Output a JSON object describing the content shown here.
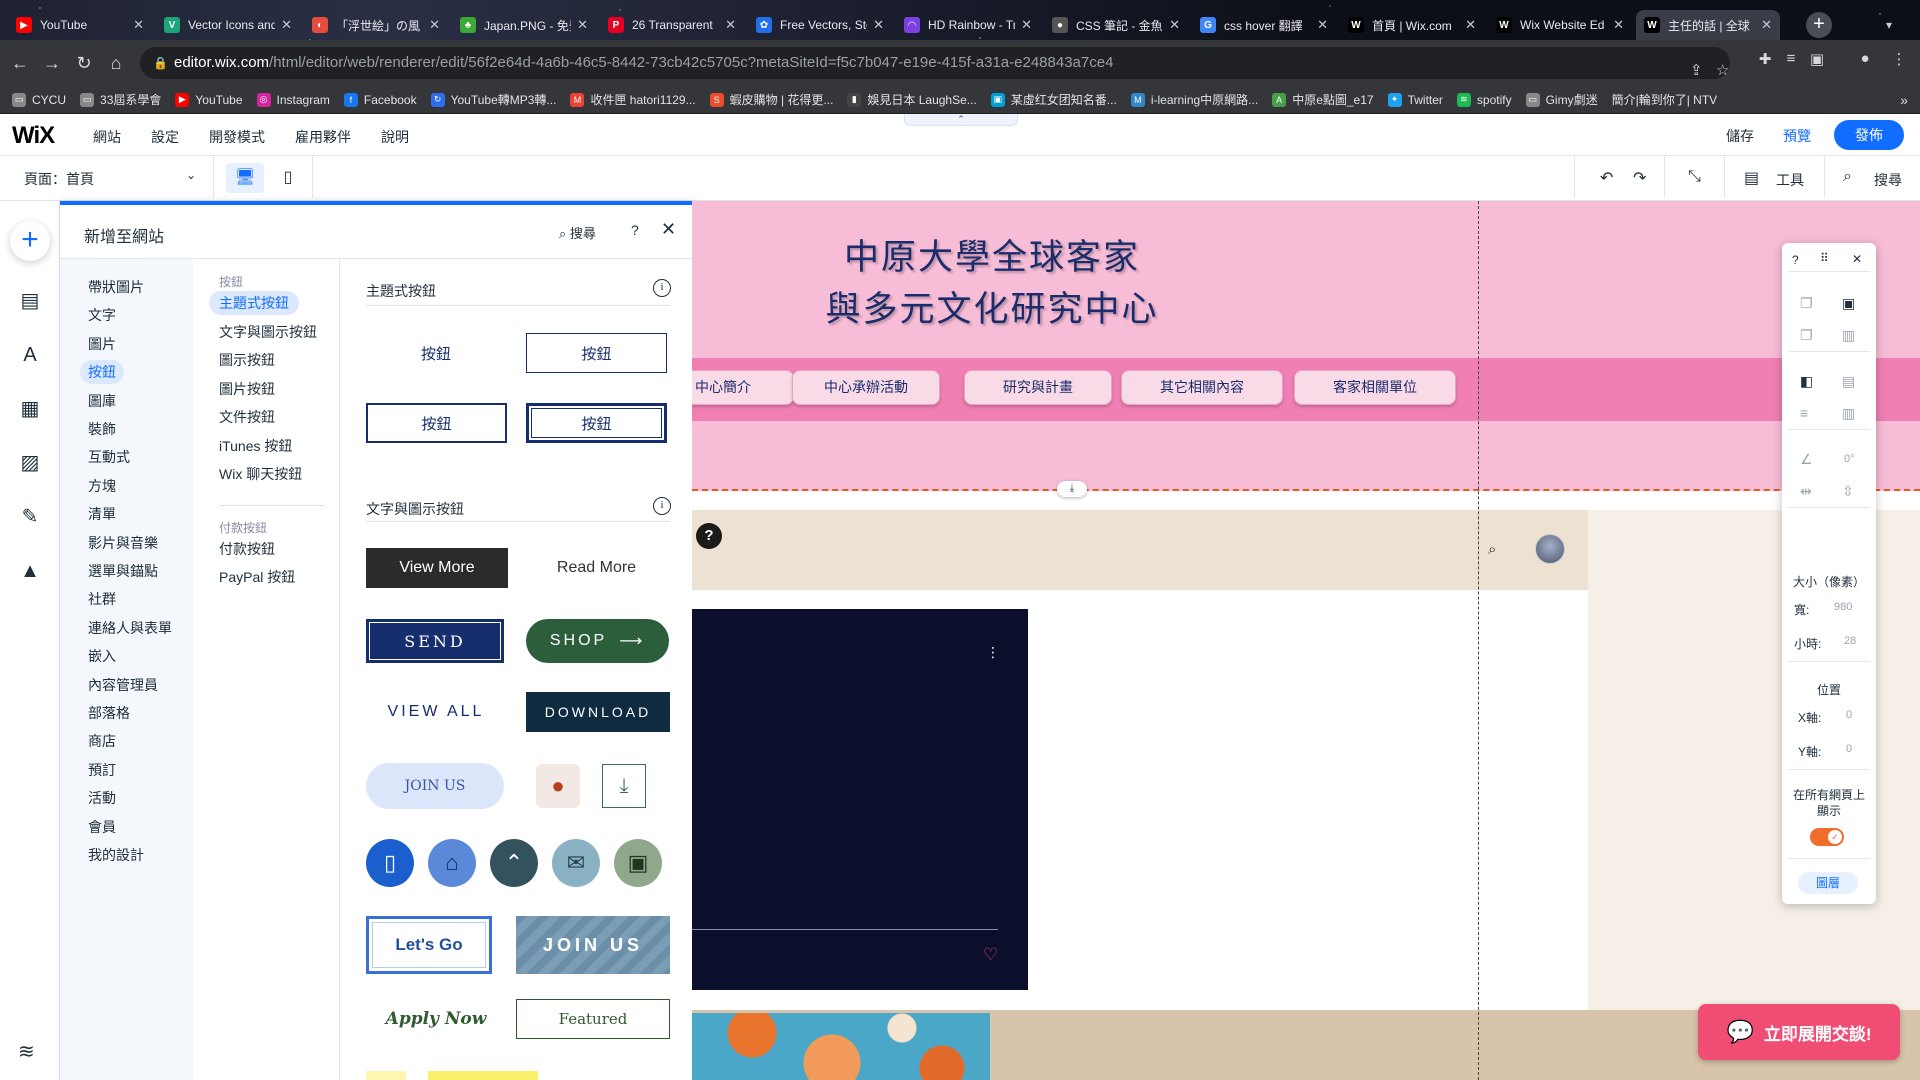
{
  "browser": {
    "tabs": [
      {
        "label": "YouTube",
        "color": "#ff0000",
        "glyph": "▶"
      },
      {
        "label": "Vector Icons and",
        "color": "#1da57a",
        "glyph": "V"
      },
      {
        "label": "「浮世絵」の風",
        "color": "#e74c3c",
        "glyph": "◐"
      },
      {
        "label": "Japan.PNG - 免費",
        "color": "#3aaa35",
        "glyph": "♣"
      },
      {
        "label": "26 Transparent",
        "color": "#e60023",
        "glyph": "P"
      },
      {
        "label": "Free Vectors, Sto",
        "color": "#1f6feb",
        "glyph": "✿"
      },
      {
        "label": "HD Rainbow - Tr",
        "color": "#7b3fe4",
        "glyph": "◠"
      },
      {
        "label": "CSS 筆記 - 金魚",
        "color": "#555555",
        "glyph": "●"
      },
      {
        "label": "css hover 翻譯",
        "color": "#4285f4",
        "glyph": "G"
      },
      {
        "label": "首頁 | Wix.com",
        "color": "#000000",
        "glyph": "W"
      },
      {
        "label": "Wix Website Ed",
        "color": "#000000",
        "glyph": "W"
      },
      {
        "label": "主任的話 | 全球",
        "color": "#000000",
        "glyph": "W"
      }
    ],
    "url_host": "editor.wix.com",
    "url_path": "/html/editor/web/renderer/edit/56f2e64d-4a6b-46c5-8442-73cb42c5705c?metaSiteId=f5c7b047-e19e-415f-a31a-e248843a7ce4",
    "bookmarks": [
      {
        "label": "CYCU",
        "color": "#888888",
        "glyph": "▭"
      },
      {
        "label": "33屆系學會",
        "color": "#888888",
        "glyph": "▭"
      },
      {
        "label": "YouTube",
        "color": "#ff0000",
        "glyph": "▶"
      },
      {
        "label": "Instagram",
        "color": "#d6249f",
        "glyph": "◎"
      },
      {
        "label": "Facebook",
        "color": "#1877f2",
        "glyph": "f"
      },
      {
        "label": "YouTube轉MP3轉...",
        "color": "#2c6ef2",
        "glyph": "↻"
      },
      {
        "label": "收件匣 hatori1129...",
        "color": "#ea4335",
        "glyph": "M"
      },
      {
        "label": "蝦皮購物 | 花得更...",
        "color": "#ee4d2d",
        "glyph": "S"
      },
      {
        "label": "娛見日本 LaughSe...",
        "color": "#444444",
        "glyph": "▮"
      },
      {
        "label": "某虛红女团知名番...",
        "color": "#00a1d6",
        "glyph": "▣"
      },
      {
        "label": "i-learning中原網路...",
        "color": "#2f86c8",
        "glyph": "M"
      },
      {
        "label": "中原e點圖_e17",
        "color": "#46a049",
        "glyph": "A"
      },
      {
        "label": "Twitter",
        "color": "#1da1f2",
        "glyph": "✦"
      },
      {
        "label": "spotify",
        "color": "#1db954",
        "glyph": "≋"
      },
      {
        "label": "Gimy劇迷",
        "color": "#888888",
        "glyph": "▭"
      },
      {
        "label": "簡介|輪到你了| NTV",
        "color": "#888888",
        "glyph": ""
      }
    ]
  },
  "wix": {
    "logo": "WiX",
    "menu": [
      "網站",
      "設定",
      "開發模式",
      "雇用夥伴",
      "說明"
    ],
    "save": "儲存",
    "preview": "預覽",
    "publish": "發佈",
    "page_label": "頁面：首頁",
    "tools_label": "工具",
    "search_label": "搜尋"
  },
  "add_panel": {
    "title": "新增至網站",
    "search": "搜尋",
    "help": "?",
    "categories": [
      "帶狀圖片",
      "文字",
      "圖片",
      "按鈕",
      "圖庫",
      "裝飾",
      "互動式",
      "方塊",
      "清單",
      "影片與音樂",
      "選單與錨點",
      "社群",
      "連絡人與表單",
      "嵌入",
      "內容管理員",
      "部落格",
      "商店",
      "預訂",
      "活動",
      "會員",
      "我的設計"
    ],
    "selected_category": 3,
    "sub_groups": [
      {
        "header": "按鈕",
        "items": [
          "主題式按鈕",
          "文字與圖示按鈕",
          "圖示按鈕",
          "圖片按鈕",
          "文件按鈕",
          "iTunes 按鈕",
          "Wix 聊天按鈕"
        ]
      },
      {
        "header": "付款按鈕",
        "items": [
          "付款按鈕",
          "PayPal 按鈕"
        ]
      }
    ],
    "section1_title": "主題式按鈕",
    "section2_title": "文字與圖示按鈕",
    "theme_button_label": "按鈕",
    "samples": {
      "view_more": "View More",
      "read_more": "Read More",
      "send": "SEND",
      "shop": "SHOP",
      "view_all": "VIEW ALL",
      "download": "DOWNLOAD",
      "join_us_pill": "JOIN US",
      "lets_go": "Let's Go",
      "join_us_leaf": "JOIN US",
      "apply_now": "Apply Now",
      "featured": "Featured"
    }
  },
  "site": {
    "title_line1": "中原大學全球客家",
    "title_line2": "與多元文化研究中心",
    "nav": [
      "中心簡介",
      "中心承辦活動",
      "研究與計畫",
      "其它相關內容",
      "客家相關單位"
    ]
  },
  "props": {
    "size_label": "大小（像素）",
    "width_label": "寬:",
    "width_value": "980",
    "height_label": "小時:",
    "height_value": "28",
    "position_label": "位置",
    "x_label": "X軸:",
    "x_value": "0",
    "y_label": "Y軸:",
    "y_value": "0",
    "angle": "0°",
    "show_all_label": "在所有網頁上顯示",
    "layers_label": "圖層"
  },
  "chat": {
    "label": "立即展開交談!"
  }
}
